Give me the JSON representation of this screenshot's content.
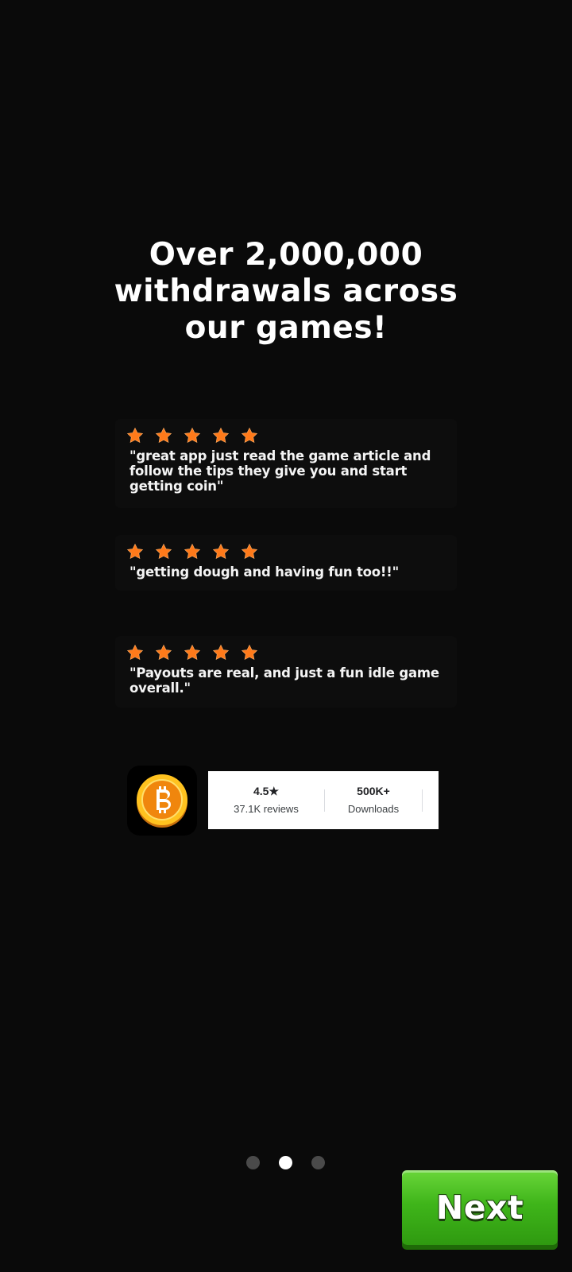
{
  "headline": "Over 2,000,000 withdrawals across our games!",
  "reviews": [
    {
      "stars": 5,
      "text": "\"great app just read the game article and follow the tips they give you and start getting coin\""
    },
    {
      "stars": 5,
      "text": "\"getting dough and having fun too!!\""
    },
    {
      "stars": 5,
      "text": "\"Payouts are real, and just a fun idle game overall.\""
    }
  ],
  "store": {
    "rating": "4.5★",
    "reviews_count": "37.1K reviews",
    "downloads": "500K+",
    "downloads_label": "Downloads"
  },
  "pager": {
    "total": 3,
    "active_index": 1
  },
  "next_button": {
    "label": "Next"
  },
  "colors": {
    "background": "#0a0a0a",
    "star": "#ff7a1a",
    "button_green": "#3fb51a",
    "coin_gold": "#f7a21b"
  },
  "icons": {
    "star": "star-icon",
    "app": "bitcoin-coin-icon"
  }
}
